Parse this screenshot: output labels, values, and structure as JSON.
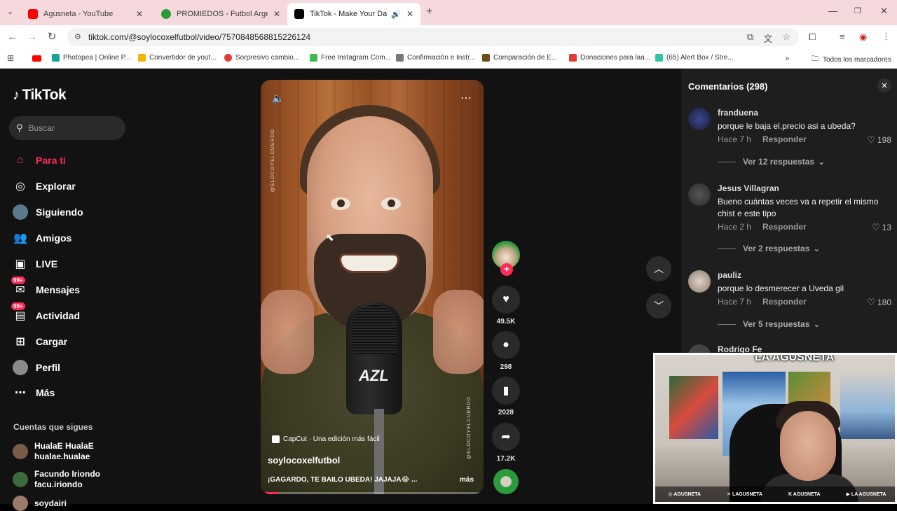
{
  "browser": {
    "tabs": [
      {
        "title": "Agusneta - YouTube",
        "icon": "youtube-icon",
        "color": "#ff0000"
      },
      {
        "title": "PROMIEDOS - Futbol Argentino",
        "icon": "promiedos-icon",
        "color": "#2e9a3a"
      },
      {
        "title": "TikTok - Make Your Day",
        "icon": "tiktok-icon",
        "color": "#000000"
      }
    ],
    "new_tab": "+",
    "url": "tiktok.com/@soylocoxelfutbol/video/7570848568815226124",
    "bookmarks": [
      {
        "label": "Photopea | Online P...",
        "color": "#18a497"
      },
      {
        "label": "Convertidor de yout...",
        "color": "#f5b400"
      },
      {
        "label": "Sorpresivo cambio...",
        "color": "#e53935"
      },
      {
        "label": "Free Instagram Com...",
        "color": "#3cba54"
      },
      {
        "label": "Confirmación e Instr...",
        "color": "#777777"
      },
      {
        "label": "Comparación de E...",
        "color": "#6d4c1b"
      },
      {
        "label": "Donaciones para laa...",
        "color": "#e53935"
      },
      {
        "label": "(65) Alert Box / Stre...",
        "color": "#2ec4a5"
      }
    ],
    "all_bookmarks": "Todos los marcadores"
  },
  "sidebar": {
    "logo": "TikTok",
    "search_placeholder": "Buscar",
    "nav": [
      {
        "label": "Para ti",
        "icon": "home-icon",
        "active": true
      },
      {
        "label": "Explorar",
        "icon": "compass-icon"
      },
      {
        "label": "Siguiendo",
        "icon": "following-icon"
      },
      {
        "label": "Amigos",
        "icon": "friends-icon"
      },
      {
        "label": "LIVE",
        "icon": "live-icon"
      },
      {
        "label": "Mensajes",
        "icon": "messages-icon",
        "badge": "99+"
      },
      {
        "label": "Actividad",
        "icon": "activity-icon",
        "badge": "99+"
      },
      {
        "label": "Cargar",
        "icon": "upload-icon"
      },
      {
        "label": "Perfil",
        "icon": "profile-icon"
      },
      {
        "label": "Más",
        "icon": "more-icon"
      }
    ],
    "following_title": "Cuentas que sigues",
    "following": [
      {
        "name": "HualaE HualaE",
        "handle": "hualae.hualae"
      },
      {
        "name": "Facundo Iriondo",
        "handle": "facu.iriondo"
      },
      {
        "name": "soydairi",
        "handle": ""
      }
    ]
  },
  "video": {
    "watermark": "@ELOCOYELCUERDO",
    "capcut": "CapCut · Una edición más fácil",
    "author": "soylocoxelfutbol",
    "caption": "¡GAGARDO, TE BAILO UBEDA! JAJAJA😂 ...",
    "more": "más",
    "mic_brand": "AZL",
    "progress": 0.08
  },
  "actions": {
    "likes": "49.5K",
    "comments": "298",
    "saves": "2028",
    "shares": "17.2K"
  },
  "comments": {
    "header": "Comentarios (298)",
    "items": [
      {
        "user": "franduena",
        "text": "porque le baja el.precio asi a ubeda?",
        "time": "Hace 7 h",
        "reply": "Responder",
        "likes": "198",
        "replies": "Ver 12 respuestas"
      },
      {
        "user": "Jesus Villagran",
        "text": "Bueno cuántas veces va a repetir el mismo chist e este tipo",
        "time": "Hace 2 h",
        "reply": "Responder",
        "likes": "13",
        "replies": "Ver 2 respuestas"
      },
      {
        "user": "pauliz",
        "text": "porque lo desmerecer a Uveda gil",
        "time": "Hace 7 h",
        "reply": "Responder",
        "likes": "180",
        "replies": "Ver 5 respuestas"
      },
      {
        "user": "Rodrigo Fe",
        "text": "",
        "time": "",
        "reply": "",
        "likes": "",
        "replies": ""
      }
    ]
  },
  "webcam": {
    "logo": "LA AGUSNETA",
    "socials": [
      "AGUSNETA",
      "LAGUSNETA",
      "AGUSNETA",
      "LA AGUSNETA"
    ]
  }
}
